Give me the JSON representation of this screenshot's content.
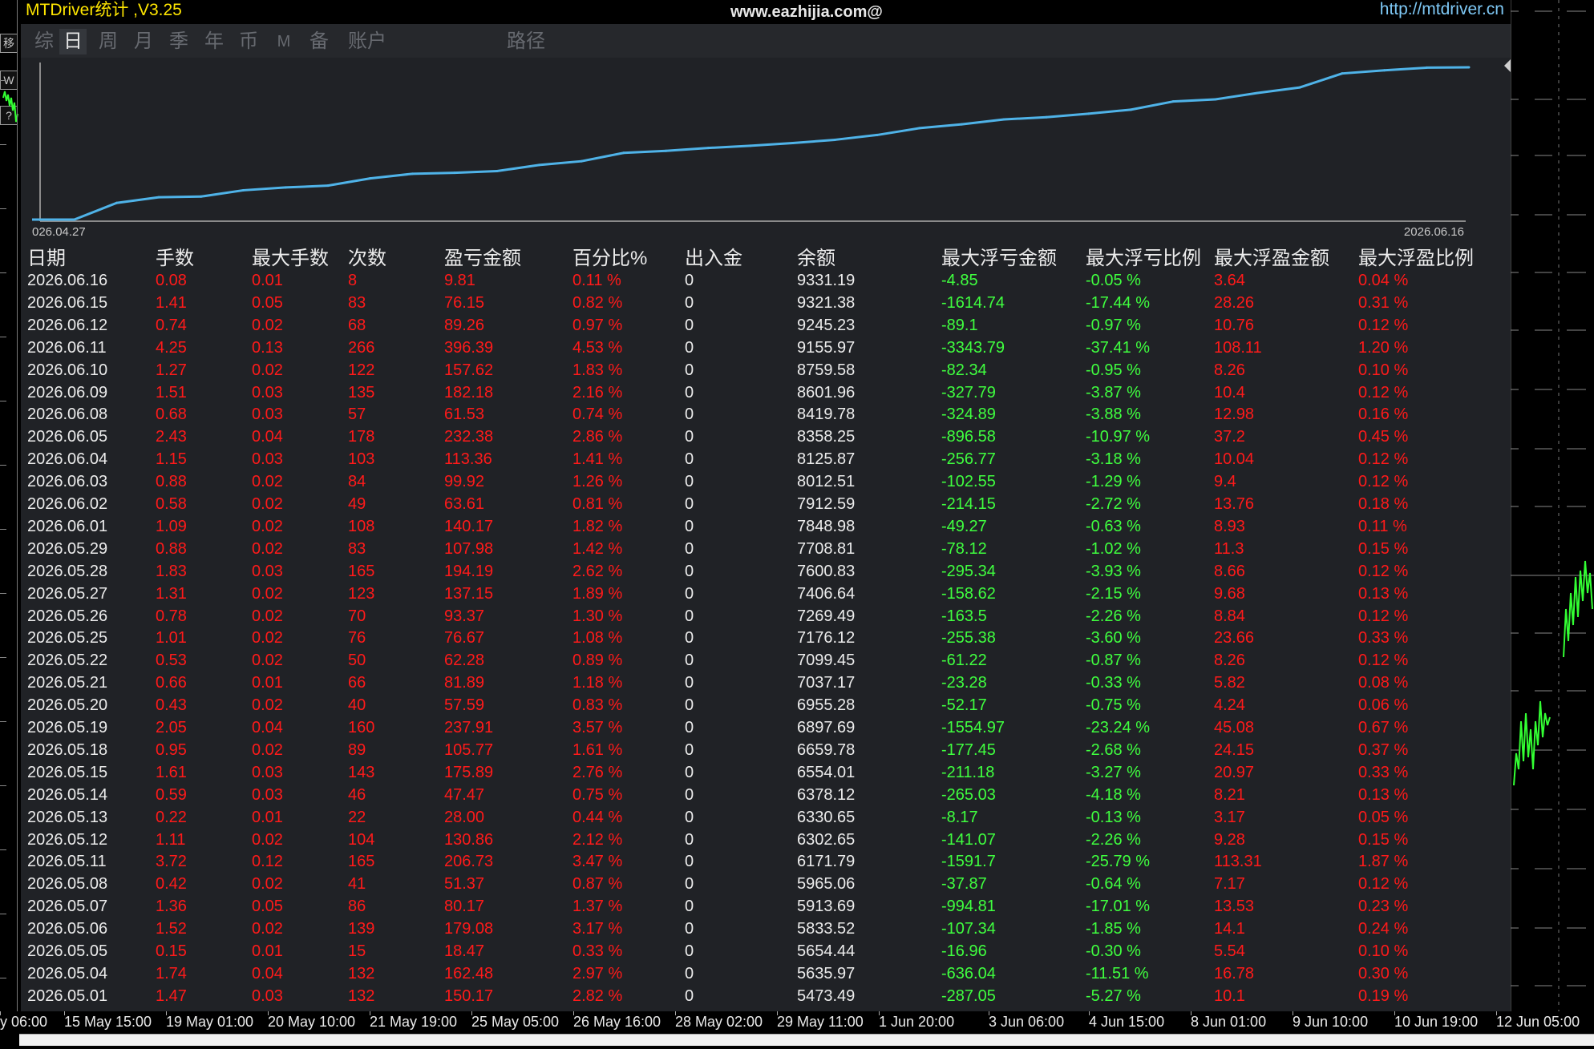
{
  "window": {
    "title": "MTDriver统计 ,V3.25",
    "watermark": "www.eazhijia.com@",
    "link": "http://mtdriver.cn"
  },
  "toolbar_buttons": [
    "移",
    "W",
    "?"
  ],
  "tabs": [
    {
      "label": "综",
      "active": false
    },
    {
      "label": "日",
      "active": true
    },
    {
      "label": "周",
      "active": false
    },
    {
      "label": "月",
      "active": false
    },
    {
      "label": "季",
      "active": false
    },
    {
      "label": "年",
      "active": false
    },
    {
      "label": "币",
      "active": false
    },
    {
      "label": "M",
      "active": false
    },
    {
      "label": "备",
      "active": false
    },
    {
      "label": "账户",
      "active": false
    },
    {
      "label": "路径",
      "active": false
    }
  ],
  "chart_data": {
    "type": "line",
    "start_label": "026.04.27",
    "end_label": "2026.06.16",
    "line_color": "#4fb3e8",
    "x": [
      "2026.05.01",
      "2026.05.04",
      "2026.05.05",
      "2026.05.06",
      "2026.05.07",
      "2026.05.08",
      "2026.05.11",
      "2026.05.12",
      "2026.05.13",
      "2026.05.14",
      "2026.05.15",
      "2026.05.18",
      "2026.05.19",
      "2026.05.20",
      "2026.05.21",
      "2026.05.22",
      "2026.05.25",
      "2026.05.26",
      "2026.05.27",
      "2026.05.28",
      "2026.05.29",
      "2026.06.01",
      "2026.06.02",
      "2026.06.03",
      "2026.06.04",
      "2026.06.05",
      "2026.06.08",
      "2026.06.09",
      "2026.06.10",
      "2026.06.11",
      "2026.06.12",
      "2026.06.15",
      "2026.06.16"
    ],
    "series": [
      {
        "values": [
          5473.49,
          5635.97,
          5654.44,
          5833.52,
          5913.69,
          5965.06,
          6171.79,
          6302.65,
          6330.65,
          6378.12,
          6554.01,
          6659.78,
          6897.69,
          6955.28,
          7037.17,
          7099.45,
          7176.12,
          7269.49,
          7406.64,
          7600.83,
          7708.81,
          7848.98,
          7912.59,
          8012.51,
          8125.87,
          8358.25,
          8419.78,
          8601.96,
          8759.58,
          9155.97,
          9245.23,
          9321.38,
          9331.19
        ]
      }
    ]
  },
  "table": {
    "headers": [
      "日期",
      "手数",
      "最大手数",
      "次数",
      "盈亏金额",
      "百分比%",
      "出入金",
      "余额",
      "最大浮亏金额",
      "最大浮亏比例",
      "最大浮盈金额",
      "最大浮盈比例"
    ],
    "rows": [
      [
        "2026.06.16",
        "0.08",
        "0.01",
        "8",
        "9.81",
        "0.11 %",
        "0",
        "9331.19",
        "-4.85",
        "-0.05 %",
        "3.64",
        "0.04 %"
      ],
      [
        "2026.06.15",
        "1.41",
        "0.05",
        "83",
        "76.15",
        "0.82 %",
        "0",
        "9321.38",
        "-1614.74",
        "-17.44 %",
        "28.26",
        "0.31 %"
      ],
      [
        "2026.06.12",
        "0.74",
        "0.02",
        "68",
        "89.26",
        "0.97 %",
        "0",
        "9245.23",
        "-89.1",
        "-0.97 %",
        "10.76",
        "0.12 %"
      ],
      [
        "2026.06.11",
        "4.25",
        "0.13",
        "266",
        "396.39",
        "4.53 %",
        "0",
        "9155.97",
        "-3343.79",
        "-37.41 %",
        "108.11",
        "1.20 %"
      ],
      [
        "2026.06.10",
        "1.27",
        "0.02",
        "122",
        "157.62",
        "1.83 %",
        "0",
        "8759.58",
        "-82.34",
        "-0.95 %",
        "8.26",
        "0.10 %"
      ],
      [
        "2026.06.09",
        "1.51",
        "0.03",
        "135",
        "182.18",
        "2.16 %",
        "0",
        "8601.96",
        "-327.79",
        "-3.87 %",
        "10.4",
        "0.12 %"
      ],
      [
        "2026.06.08",
        "0.68",
        "0.03",
        "57",
        "61.53",
        "0.74 %",
        "0",
        "8419.78",
        "-324.89",
        "-3.88 %",
        "12.98",
        "0.16 %"
      ],
      [
        "2026.06.05",
        "2.43",
        "0.04",
        "178",
        "232.38",
        "2.86 %",
        "0",
        "8358.25",
        "-896.58",
        "-10.97 %",
        "37.2",
        "0.45 %"
      ],
      [
        "2026.06.04",
        "1.15",
        "0.03",
        "103",
        "113.36",
        "1.41 %",
        "0",
        "8125.87",
        "-256.77",
        "-3.18 %",
        "10.04",
        "0.12 %"
      ],
      [
        "2026.06.03",
        "0.88",
        "0.02",
        "84",
        "99.92",
        "1.26 %",
        "0",
        "8012.51",
        "-102.55",
        "-1.29 %",
        "9.4",
        "0.12 %"
      ],
      [
        "2026.06.02",
        "0.58",
        "0.02",
        "49",
        "63.61",
        "0.81 %",
        "0",
        "7912.59",
        "-214.15",
        "-2.72 %",
        "13.76",
        "0.18 %"
      ],
      [
        "2026.06.01",
        "1.09",
        "0.02",
        "108",
        "140.17",
        "1.82 %",
        "0",
        "7848.98",
        "-49.27",
        "-0.63 %",
        "8.93",
        "0.11 %"
      ],
      [
        "2026.05.29",
        "0.88",
        "0.02",
        "83",
        "107.98",
        "1.42 %",
        "0",
        "7708.81",
        "-78.12",
        "-1.02 %",
        "11.3",
        "0.15 %"
      ],
      [
        "2026.05.28",
        "1.83",
        "0.03",
        "165",
        "194.19",
        "2.62 %",
        "0",
        "7600.83",
        "-295.34",
        "-3.93 %",
        "8.66",
        "0.12 %"
      ],
      [
        "2026.05.27",
        "1.31",
        "0.02",
        "123",
        "137.15",
        "1.89 %",
        "0",
        "7406.64",
        "-158.62",
        "-2.15 %",
        "9.68",
        "0.13 %"
      ],
      [
        "2026.05.26",
        "0.78",
        "0.02",
        "70",
        "93.37",
        "1.30 %",
        "0",
        "7269.49",
        "-163.5",
        "-2.26 %",
        "8.84",
        "0.12 %"
      ],
      [
        "2026.05.25",
        "1.01",
        "0.02",
        "76",
        "76.67",
        "1.08 %",
        "0",
        "7176.12",
        "-255.38",
        "-3.60 %",
        "23.66",
        "0.33 %"
      ],
      [
        "2026.05.22",
        "0.53",
        "0.02",
        "50",
        "62.28",
        "0.89 %",
        "0",
        "7099.45",
        "-61.22",
        "-0.87 %",
        "8.26",
        "0.12 %"
      ],
      [
        "2026.05.21",
        "0.66",
        "0.01",
        "66",
        "81.89",
        "1.18 %",
        "0",
        "7037.17",
        "-23.28",
        "-0.33 %",
        "5.82",
        "0.08 %"
      ],
      [
        "2026.05.20",
        "0.43",
        "0.02",
        "40",
        "57.59",
        "0.83 %",
        "0",
        "6955.28",
        "-52.17",
        "-0.75 %",
        "4.24",
        "0.06 %"
      ],
      [
        "2026.05.19",
        "2.05",
        "0.04",
        "160",
        "237.91",
        "3.57 %",
        "0",
        "6897.69",
        "-1554.97",
        "-23.24 %",
        "45.08",
        "0.67 %"
      ],
      [
        "2026.05.18",
        "0.95",
        "0.02",
        "89",
        "105.77",
        "1.61 %",
        "0",
        "6659.78",
        "-177.45",
        "-2.68 %",
        "24.15",
        "0.37 %"
      ],
      [
        "2026.05.15",
        "1.61",
        "0.03",
        "143",
        "175.89",
        "2.76 %",
        "0",
        "6554.01",
        "-211.18",
        "-3.27 %",
        "20.97",
        "0.33 %"
      ],
      [
        "2026.05.14",
        "0.59",
        "0.03",
        "46",
        "47.47",
        "0.75 %",
        "0",
        "6378.12",
        "-265.03",
        "-4.18 %",
        "8.21",
        "0.13 %"
      ],
      [
        "2026.05.13",
        "0.22",
        "0.01",
        "22",
        "28.00",
        "0.44 %",
        "0",
        "6330.65",
        "-8.17",
        "-0.13 %",
        "3.17",
        "0.05 %"
      ],
      [
        "2026.05.12",
        "1.11",
        "0.02",
        "104",
        "130.86",
        "2.12 %",
        "0",
        "6302.65",
        "-141.07",
        "-2.26 %",
        "9.28",
        "0.15 %"
      ],
      [
        "2026.05.11",
        "3.72",
        "0.12",
        "165",
        "206.73",
        "3.47 %",
        "0",
        "6171.79",
        "-1591.7",
        "-25.79 %",
        "113.31",
        "1.87 %"
      ],
      [
        "2026.05.08",
        "0.42",
        "0.02",
        "41",
        "51.37",
        "0.87 %",
        "0",
        "5965.06",
        "-37.87",
        "-0.64 %",
        "7.17",
        "0.12 %"
      ],
      [
        "2026.05.07",
        "1.36",
        "0.05",
        "86",
        "80.17",
        "1.37 %",
        "0",
        "5913.69",
        "-994.81",
        "-17.01 %",
        "13.53",
        "0.23 %"
      ],
      [
        "2026.05.06",
        "1.52",
        "0.02",
        "139",
        "179.08",
        "3.17 %",
        "0",
        "5833.52",
        "-107.34",
        "-1.85 %",
        "14.1",
        "0.24 %"
      ],
      [
        "2026.05.05",
        "0.15",
        "0.01",
        "15",
        "18.47",
        "0.33 %",
        "0",
        "5654.44",
        "-16.96",
        "-0.30 %",
        "5.54",
        "0.10 %"
      ],
      [
        "2026.05.04",
        "1.74",
        "0.04",
        "132",
        "162.48",
        "2.97 %",
        "0",
        "5635.97",
        "-636.04",
        "-11.51 %",
        "16.78",
        "0.30 %"
      ],
      [
        "2026.05.01",
        "1.47",
        "0.03",
        "132",
        "150.17",
        "2.82 %",
        "0",
        "5473.49",
        "-287.05",
        "-5.27 %",
        "10.1",
        "0.19 %"
      ]
    ]
  },
  "time_axis": [
    "y 06:00",
    "15 May 15:00",
    "19 May 01:00",
    "20 May 10:00",
    "21 May 19:00",
    "25 May 05:00",
    "26 May 16:00",
    "28 May 02:00",
    "29 May 11:00",
    "1 Jun 20:00",
    "3 Jun 06:00",
    "4 Jun 15:00",
    "8 Jun 01:00",
    "9 Jun 10:00",
    "10 Jun 19:00",
    "12 Jun 05:00"
  ],
  "colors": {
    "panel_bg": "#202226",
    "header_text": "#ececec",
    "title": "#ffe600",
    "link": "#7ec8f5",
    "positive": "#ff1a1a",
    "negative": "#3fff3f",
    "equity_line": "#4fb3e8",
    "candles": "#33ff33"
  }
}
